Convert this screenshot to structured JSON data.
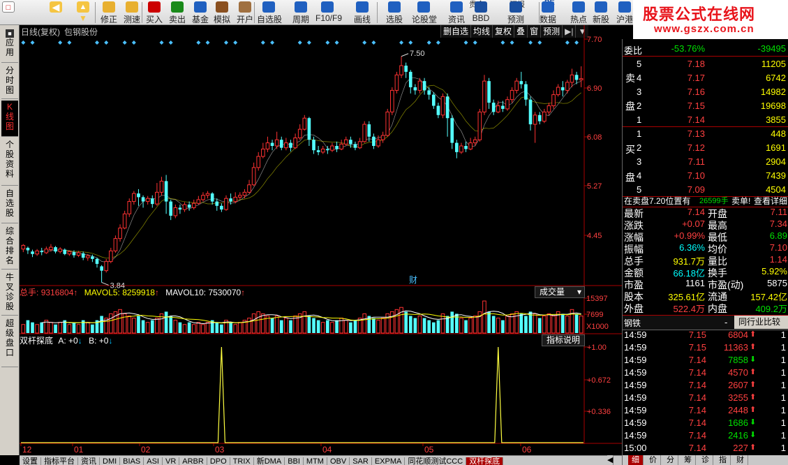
{
  "toolbar": {
    "buttons": [
      {
        "label": "修正",
        "icon": "refresh-icon"
      },
      {
        "label": "测速",
        "icon": "clock-icon"
      },
      {
        "label": "买入",
        "icon": "buy-icon"
      },
      {
        "label": "卖出",
        "icon": "sell-icon"
      },
      {
        "label": "基金",
        "icon": "fund-icon"
      },
      {
        "label": "模拟",
        "icon": "hammer-icon"
      },
      {
        "label": "开户",
        "icon": "bag-icon"
      },
      {
        "label": "自选股",
        "icon": "star-icon"
      },
      {
        "label": "周期",
        "icon": "cycle-icon"
      },
      {
        "label": "F10/F9",
        "icon": "f10-icon"
      },
      {
        "label": "画线",
        "icon": "pen-icon"
      },
      {
        "label": "选股",
        "icon": "pick-icon"
      },
      {
        "label": "论股堂",
        "icon": "forum-icon"
      },
      {
        "label": "资讯",
        "icon": "news-icon"
      },
      {
        "label": "BBD",
        "icon": "bbd-icon"
      },
      {
        "label": "预测",
        "icon": "forecast-icon"
      },
      {
        "label": "数据",
        "icon": "data-icon"
      },
      {
        "label": "热点",
        "icon": "hot-icon"
      },
      {
        "label": "新股",
        "icon": "ipo-icon"
      },
      {
        "label": "沪港",
        "icon": "hk-icon"
      }
    ],
    "top_labels": {
      "gold": "贵金",
      "research": "研报",
      "pe": "PE"
    }
  },
  "watermark": {
    "line1": "股票公式在线网",
    "line2": "www.gszx.com.cn"
  },
  "left_nav": [
    {
      "label": "应用",
      "active": false
    },
    {
      "label": "分时图",
      "active": false
    },
    {
      "label": "K线图",
      "active": true
    },
    {
      "label": "个股资料",
      "active": false
    },
    {
      "label": "自选股",
      "active": false
    },
    {
      "label": "综合排名",
      "active": false
    },
    {
      "label": "牛叉诊股",
      "active": false
    },
    {
      "label": "超级盘口",
      "active": false
    }
  ],
  "chart": {
    "title": "日线(复权)",
    "stock_name": "包钢股份",
    "tools": [
      "删自选",
      "均线",
      "复权",
      "叠",
      "窗",
      "预测",
      "▶|",
      "▼"
    ],
    "price_axis": [
      "7.70",
      "6.90",
      "6.08",
      "5.27",
      "4.45"
    ],
    "annot_high": "7.50",
    "annot_low": "3.84",
    "fin_mark": "财",
    "volume_head": {
      "total_label": "总手:",
      "total": "9316804",
      "mavol5_label": "MAVOL5:",
      "mavol5": "8259918",
      "mavol10_label": "MAVOL10:",
      "mavol10": "7530070"
    },
    "volume_select": "成交量",
    "volume_axis": [
      "15397",
      "7699",
      "X1000"
    ],
    "indicator_head": {
      "name": "双杆探底",
      "a_label": "A:",
      "a": "+0",
      "b_label": "B:",
      "b": "+0"
    },
    "indicator_button": "指标说明",
    "indicator_axis": [
      "+1.00",
      "+0.672",
      "+0.336"
    ],
    "x_labels": [
      "12",
      "01",
      "02",
      "03",
      "04",
      "05",
      "06"
    ]
  },
  "chart_data": {
    "type": "candlestick",
    "ylim": [
      3.8,
      7.78
    ],
    "candles": [
      [
        4.38,
        4.44,
        4.33,
        4.46
      ],
      [
        4.4,
        4.36,
        4.3,
        4.42
      ],
      [
        4.34,
        4.3,
        4.25,
        4.37
      ],
      [
        4.3,
        4.35,
        4.27,
        4.38
      ],
      [
        4.35,
        4.33,
        4.28,
        4.4
      ],
      [
        4.32,
        4.38,
        4.3,
        4.42
      ],
      [
        4.37,
        4.41,
        4.34,
        4.46
      ],
      [
        4.41,
        4.34,
        4.31,
        4.43
      ],
      [
        4.34,
        4.38,
        4.31,
        4.41
      ],
      [
        4.37,
        4.3,
        4.28,
        4.39
      ],
      [
        4.3,
        4.34,
        4.27,
        4.36
      ],
      [
        4.33,
        4.28,
        4.24,
        4.36
      ],
      [
        4.28,
        4.32,
        4.25,
        4.35
      ],
      [
        4.31,
        4.24,
        4.2,
        4.34
      ],
      [
        4.24,
        4.27,
        4.19,
        4.3
      ],
      [
        4.26,
        4.22,
        4.17,
        4.29
      ],
      [
        4.22,
        4.14,
        4.08,
        4.24
      ],
      [
        4.1,
        4.03,
        3.84,
        4.12
      ],
      [
        4.03,
        4.18,
        4.0,
        4.22
      ],
      [
        4.18,
        4.35,
        4.15,
        4.4
      ],
      [
        4.35,
        4.55,
        4.32,
        4.6
      ],
      [
        4.55,
        4.72,
        4.5,
        4.78
      ],
      [
        4.72,
        4.95,
        4.7,
        5.0
      ],
      [
        4.95,
        5.15,
        4.9,
        5.2
      ],
      [
        5.15,
        5.28,
        5.1,
        5.32
      ],
      [
        5.28,
        5.22,
        5.08,
        5.35
      ],
      [
        5.22,
        5.15,
        5.05,
        5.25
      ],
      [
        5.15,
        5.2,
        5.1,
        5.24
      ],
      [
        5.2,
        5.11,
        5.05,
        5.25
      ],
      [
        5.11,
        5.3,
        5.08,
        5.45
      ],
      [
        5.3,
        5.48,
        5.25,
        5.55
      ],
      [
        5.48,
        5.15,
        4.95,
        5.58
      ],
      [
        5.15,
        4.92,
        4.85,
        5.18
      ],
      [
        4.92,
        5.05,
        4.88,
        5.1
      ],
      [
        5.05,
        5.02,
        4.95,
        5.1
      ],
      [
        5.02,
        5.1,
        4.98,
        5.14
      ],
      [
        5.1,
        5.05,
        5.0,
        5.15
      ],
      [
        5.05,
        5.12,
        5.02,
        5.18
      ],
      [
        5.12,
        5.18,
        5.1,
        5.24
      ],
      [
        5.18,
        5.25,
        5.15,
        5.3
      ],
      [
        5.25,
        5.28,
        5.2,
        5.32
      ],
      [
        5.28,
        5.15,
        5.1,
        5.3
      ],
      [
        5.15,
        5.08,
        5.0,
        5.2
      ],
      [
        5.08,
        5.02,
        4.98,
        5.12
      ],
      [
        5.02,
        5.2,
        5.0,
        5.25
      ],
      [
        5.2,
        5.15,
        5.1,
        5.28
      ],
      [
        5.15,
        5.22,
        5.12,
        5.3
      ],
      [
        5.22,
        5.25,
        5.18,
        5.3
      ],
      [
        5.25,
        5.3,
        5.2,
        5.35
      ],
      [
        5.3,
        5.42,
        5.28,
        5.5
      ],
      [
        5.42,
        5.7,
        5.4,
        5.78
      ],
      [
        5.7,
        5.88,
        5.65,
        5.95
      ],
      [
        5.88,
        6.0,
        5.85,
        6.1
      ],
      [
        6.0,
        6.1,
        5.95,
        6.2
      ],
      [
        6.1,
        6.05,
        5.98,
        6.15
      ],
      [
        6.05,
        6.15,
        6.0,
        6.28
      ],
      [
        6.15,
        6.02,
        5.98,
        6.2
      ],
      [
        6.02,
        6.1,
        5.98,
        6.18
      ],
      [
        6.1,
        6.02,
        5.96,
        6.15
      ],
      [
        6.02,
        6.18,
        6.0,
        6.25
      ],
      [
        6.18,
        6.32,
        6.15,
        6.4
      ],
      [
        6.32,
        6.5,
        6.3,
        6.55
      ],
      [
        6.5,
        6.15,
        6.05,
        6.52
      ],
      [
        6.15,
        5.98,
        5.92,
        6.2
      ],
      [
        5.98,
        5.95,
        5.9,
        6.05
      ],
      [
        5.95,
        6.0,
        5.92,
        6.05
      ],
      [
        6.0,
        5.98,
        5.92,
        6.05
      ],
      [
        5.98,
        6.05,
        5.95,
        6.1
      ],
      [
        6.05,
        6.0,
        5.95,
        6.12
      ],
      [
        6.0,
        6.08,
        5.98,
        6.15
      ],
      [
        6.08,
        6.15,
        6.05,
        6.2
      ],
      [
        6.15,
        6.08,
        6.02,
        6.2
      ],
      [
        6.08,
        6.02,
        5.98,
        6.12
      ],
      [
        6.02,
        6.12,
        6.0,
        6.18
      ],
      [
        6.12,
        6.4,
        6.1,
        6.45
      ],
      [
        6.4,
        6.2,
        6.12,
        6.45
      ],
      [
        6.2,
        6.05,
        6.0,
        6.25
      ],
      [
        6.05,
        6.15,
        6.02,
        6.22
      ],
      [
        6.15,
        6.22,
        6.1,
        6.28
      ],
      [
        6.22,
        6.6,
        6.2,
        6.65
      ],
      [
        6.6,
        6.95,
        6.55,
        7.0
      ],
      [
        6.95,
        7.2,
        6.9,
        7.25
      ],
      [
        7.2,
        7.35,
        7.15,
        7.5
      ],
      [
        7.35,
        7.25,
        7.15,
        7.4
      ],
      [
        7.25,
        7.0,
        6.9,
        7.28
      ],
      [
        7.0,
        6.95,
        6.88,
        7.05
      ],
      [
        6.95,
        7.1,
        6.9,
        7.15
      ],
      [
        7.1,
        6.95,
        6.88,
        7.15
      ],
      [
        6.95,
        6.88,
        6.8,
        7.0
      ],
      [
        6.88,
        6.7,
        6.65,
        6.92
      ],
      [
        6.7,
        6.55,
        6.5,
        6.75
      ],
      [
        6.55,
        6.85,
        6.5,
        6.9
      ],
      [
        6.85,
        6.5,
        6.2,
        6.9
      ],
      [
        6.5,
        6.1,
        6.0,
        6.55
      ],
      [
        6.1,
        5.95,
        5.85,
        6.15
      ],
      [
        5.95,
        6.05,
        5.92,
        6.1
      ],
      [
        6.05,
        6.0,
        5.95,
        6.12
      ],
      [
        6.0,
        6.1,
        5.98,
        6.18
      ],
      [
        6.1,
        6.15,
        6.05,
        6.2
      ],
      [
        6.15,
        6.6,
        6.12,
        6.65
      ],
      [
        6.6,
        7.1,
        6.55,
        7.2
      ],
      [
        7.1,
        6.75,
        6.65,
        7.15
      ],
      [
        6.75,
        6.6,
        6.55,
        6.8
      ],
      [
        6.6,
        6.7,
        6.58,
        6.78
      ],
      [
        6.7,
        6.65,
        6.6,
        6.78
      ],
      [
        6.65,
        6.8,
        6.62,
        6.85
      ],
      [
        6.8,
        6.95,
        6.75,
        7.0
      ],
      [
        6.95,
        7.1,
        6.9,
        7.15
      ],
      [
        7.1,
        7.05,
        6.98,
        7.25
      ],
      [
        7.05,
        6.8,
        6.7,
        7.1
      ],
      [
        6.8,
        6.4,
        6.3,
        6.85
      ],
      [
        6.4,
        6.55,
        6.1,
        6.6
      ],
      [
        6.55,
        6.45,
        6.4,
        6.6
      ],
      [
        6.45,
        6.6,
        6.42,
        6.65
      ],
      [
        6.6,
        6.7,
        6.55,
        6.75
      ],
      [
        6.7,
        6.88,
        6.65,
        6.95
      ],
      [
        6.88,
        7.0,
        6.85,
        7.05
      ],
      [
        7.0,
        6.95,
        6.85,
        7.1
      ],
      [
        6.95,
        7.08,
        6.9,
        7.12
      ],
      [
        7.08,
        7.2,
        7.0,
        7.3
      ],
      [
        7.2,
        7.12,
        7.05,
        7.25
      ],
      [
        7.12,
        7.14,
        7.0,
        7.34
      ]
    ],
    "volume": [
      4,
      6,
      5,
      4,
      5,
      6,
      5,
      4,
      5,
      6,
      4,
      5,
      4,
      6,
      5,
      4,
      6,
      8,
      7,
      9,
      10,
      11,
      9,
      8,
      7,
      8,
      6,
      5,
      6,
      7,
      9,
      10,
      8,
      6,
      5,
      4,
      5,
      4,
      5,
      4,
      5,
      6,
      5,
      4,
      6,
      5,
      4,
      5,
      6,
      7,
      9,
      10,
      9,
      8,
      7,
      8,
      6,
      7,
      6,
      8,
      9,
      10,
      8,
      7,
      6,
      5,
      6,
      5,
      6,
      7,
      6,
      5,
      6,
      7,
      9,
      8,
      7,
      6,
      7,
      9,
      10,
      11,
      12,
      10,
      8,
      7,
      8,
      7,
      6,
      5,
      6,
      9,
      8,
      10,
      9,
      7,
      6,
      7,
      8,
      10,
      15,
      10,
      8,
      7,
      6,
      8,
      9,
      10,
      9,
      8,
      10,
      9,
      7,
      8,
      9,
      8,
      10,
      9,
      8,
      11,
      9,
      8
    ],
    "volume_axis_max": 15397,
    "signal_peaks": [
      43,
      103
    ]
  },
  "right_panel": {
    "weibi_label": "委比",
    "weibi_pct": "-53.76%",
    "weibi_val": "-39495",
    "sell_label": "卖盘",
    "buy_label": "买盘",
    "sell": [
      {
        "n": "5",
        "p": "7.18",
        "v": "11205"
      },
      {
        "n": "4",
        "p": "7.17",
        "v": "6742"
      },
      {
        "n": "3",
        "p": "7.16",
        "v": "14982"
      },
      {
        "n": "2",
        "p": "7.15",
        "v": "19698"
      },
      {
        "n": "1",
        "p": "7.14",
        "v": "3855"
      }
    ],
    "buy": [
      {
        "n": "1",
        "p": "7.13",
        "v": "448"
      },
      {
        "n": "2",
        "p": "7.12",
        "v": "1691"
      },
      {
        "n": "3",
        "p": "7.11",
        "v": "2904"
      },
      {
        "n": "4",
        "p": "7.10",
        "v": "7439"
      },
      {
        "n": "5",
        "p": "7.09",
        "v": "4504"
      }
    ],
    "notice_a": "在卖盘7.20位置有",
    "notice_b": "26599手",
    "notice_c": "卖单!",
    "notice_link": "查看详细",
    "stats": [
      {
        "l1": "最新",
        "v1": "7.14",
        "c1": "red",
        "l2": "开盘",
        "v2": "7.11",
        "c2": "red"
      },
      {
        "l1": "涨跌",
        "v1": "+0.07",
        "c1": "red",
        "l2": "最高",
        "v2": "7.34",
        "c2": "red"
      },
      {
        "l1": "涨幅",
        "v1": "+0.99%",
        "c1": "red",
        "l2": "最低",
        "v2": "6.89",
        "c2": "grn"
      },
      {
        "l1": "振幅",
        "v1": "6.36%",
        "c1": "cyn",
        "l2": "均价",
        "v2": "7.10",
        "c2": "red"
      },
      {
        "l1": "总手",
        "v1": "931.7万",
        "c1": "yel",
        "l2": "量比",
        "v2": "1.14",
        "c2": "red"
      },
      {
        "l1": "金额",
        "v1": "66.18亿",
        "c1": "cyn",
        "l2": "换手",
        "v2": "5.92%",
        "c2": "yel"
      },
      {
        "l1": "市盈",
        "v1": "1161",
        "c1": "wht",
        "l2": "市盈(动)",
        "v2": "5875",
        "c2": "wht"
      },
      {
        "l1": "股本",
        "v1": "325.61亿",
        "c1": "yel",
        "l2": "流通",
        "v2": "157.42亿",
        "c2": "yel"
      },
      {
        "l1": "外盘",
        "v1": "522.4万",
        "c1": "red",
        "l2": "内盘",
        "v2": "409.2万",
        "c2": "grn"
      }
    ],
    "industry": "钢铁",
    "industry_compare": "同行业比较",
    "trades": [
      {
        "t": "14:59",
        "p": "7.15",
        "v": "6804",
        "d": "up",
        "x": "1"
      },
      {
        "t": "14:59",
        "p": "7.15",
        "v": "11363",
        "d": "up",
        "x": "1"
      },
      {
        "t": "14:59",
        "p": "7.14",
        "v": "7858",
        "d": "down",
        "x": "1"
      },
      {
        "t": "14:59",
        "p": "7.14",
        "v": "4570",
        "d": "up",
        "x": "1"
      },
      {
        "t": "14:59",
        "p": "7.14",
        "v": "2607",
        "d": "up",
        "x": "1"
      },
      {
        "t": "14:59",
        "p": "7.14",
        "v": "3255",
        "d": "up",
        "x": "1"
      },
      {
        "t": "14:59",
        "p": "7.14",
        "v": "2448",
        "d": "up",
        "x": "1"
      },
      {
        "t": "14:59",
        "p": "7.14",
        "v": "1686",
        "d": "down",
        "x": "1"
      },
      {
        "t": "14:59",
        "p": "7.14",
        "v": "2416",
        "d": "down",
        "x": "1"
      },
      {
        "t": "15:00",
        "p": "7.14",
        "v": "227",
        "d": "up",
        "x": "1"
      }
    ],
    "tabs": [
      "细",
      "价",
      "分",
      "筹",
      "诊",
      "指",
      "财"
    ]
  },
  "bottom_tabs": [
    "设置",
    "指标平台",
    "资讯",
    "DMI",
    "BIAS",
    "ASI",
    "VR",
    "ARBR",
    "DPO",
    "TRIX",
    "新DMA",
    "BBI",
    "MTM",
    "OBV",
    "SAR",
    "EXPMA",
    "同花顺测试CCC",
    "双杆探底"
  ],
  "colors": {
    "up": "#ff3232",
    "down": "#54ffff",
    "ma5": "#ffffff",
    "ma10": "#ffff00",
    "signal": "#ffff40"
  }
}
